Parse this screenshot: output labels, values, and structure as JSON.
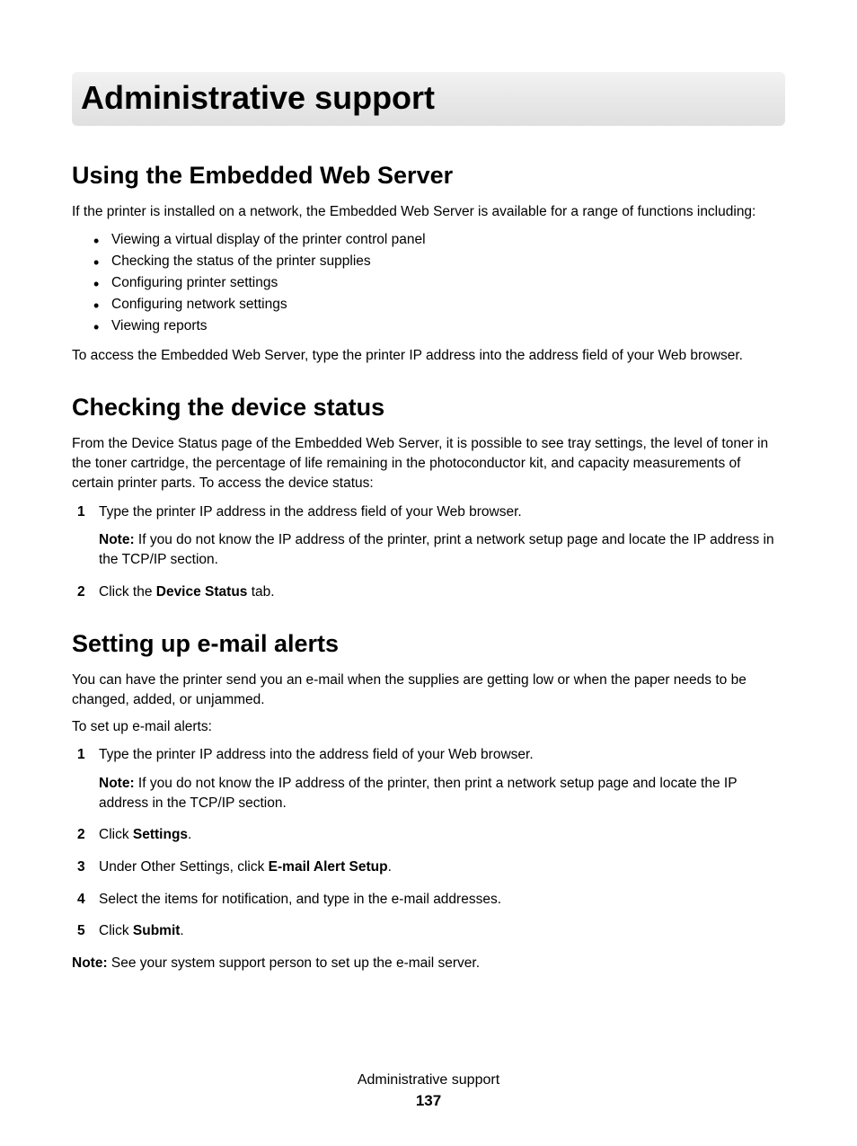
{
  "page_title": "Administrative support",
  "section1": {
    "title": "Using the Embedded Web Server",
    "intro": "If the printer is installed on a network, the Embedded Web Server is available for a range of functions including:",
    "bullets": [
      "Viewing a virtual display of the printer control panel",
      "Checking the status of the printer supplies",
      "Configuring printer settings",
      "Configuring network settings",
      "Viewing reports"
    ],
    "outro": "To access the Embedded Web Server, type the printer IP address into the address field of your Web browser."
  },
  "section2": {
    "title": "Checking the device status",
    "intro": "From the Device Status page of the Embedded Web Server, it is possible to see tray settings, the level of toner in the toner cartridge, the percentage of life remaining in the photoconductor kit, and capacity measurements of certain printer parts. To access the device status:",
    "step1": "Type the printer IP address in the address field of your Web browser.",
    "note_label": "Note:",
    "note_text": " If you do not know the IP address of the printer, print a network setup page and locate the IP address in the TCP/IP section.",
    "step2_pre": "Click the ",
    "step2_bold": "Device Status",
    "step2_post": " tab."
  },
  "section3": {
    "title": "Setting up e-mail alerts",
    "intro": "You can have the printer send you an e-mail when the supplies are getting low or when the paper needs to be changed, added, or unjammed.",
    "lead": "To set up e-mail alerts:",
    "step1": "Type the printer IP address into the address field of your Web browser.",
    "note_label": "Note:",
    "note_text": " If you do not know the IP address of the printer, then print a network setup page and locate the IP address in the TCP/IP section.",
    "step2_pre": "Click ",
    "step2_bold": "Settings",
    "step2_post": ".",
    "step3_pre": "Under Other Settings, click ",
    "step3_bold": "E-mail Alert Setup",
    "step3_post": ".",
    "step4": "Select the items for notification, and type in the e-mail addresses.",
    "step5_pre": "Click ",
    "step5_bold": "Submit",
    "step5_post": ".",
    "final_note_label": "Note:",
    "final_note_text": " See your system support person to set up the e-mail server."
  },
  "footer": {
    "title": "Administrative support",
    "page": "137"
  }
}
